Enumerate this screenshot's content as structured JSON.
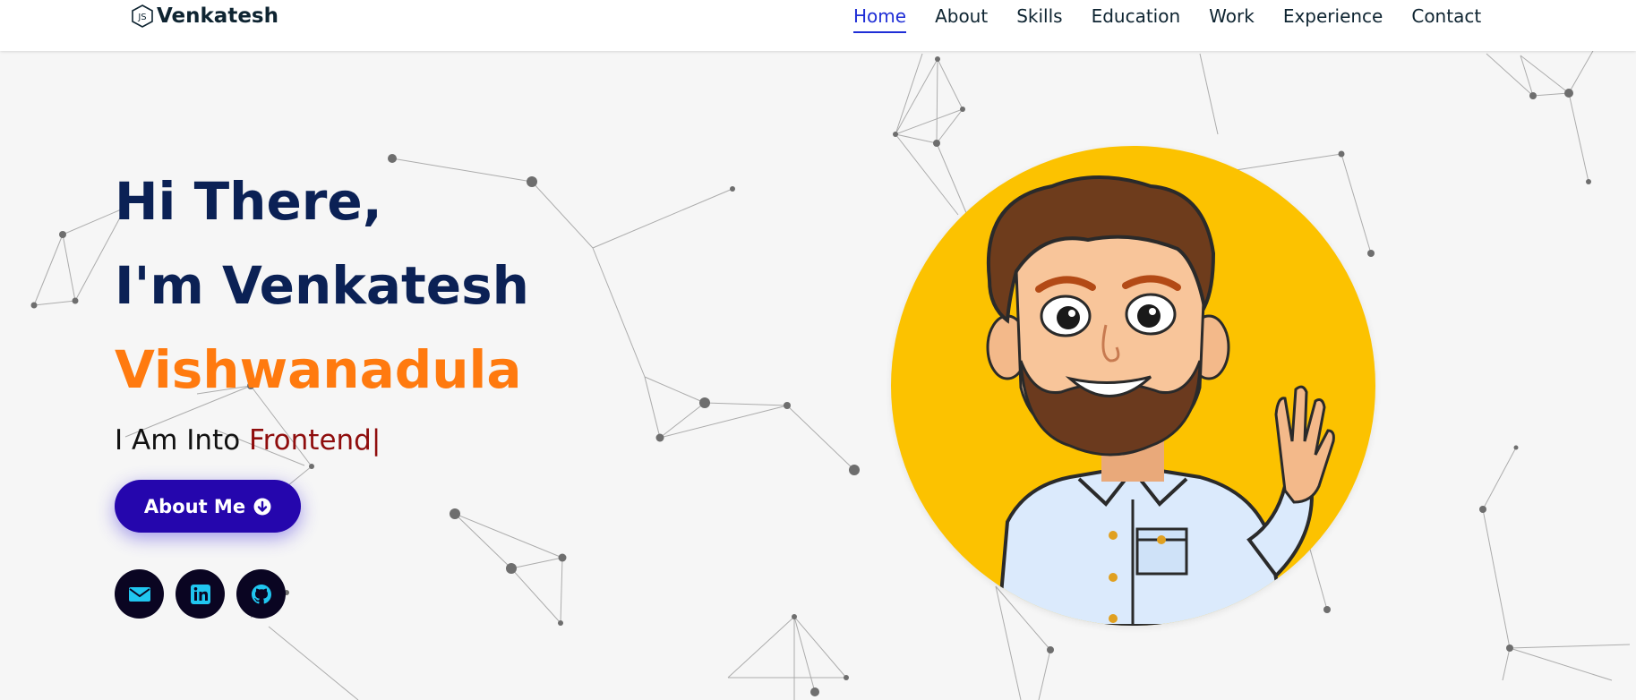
{
  "nav": {
    "brand": "Venkatesh",
    "links": [
      {
        "label": "Home",
        "active": true
      },
      {
        "label": "About",
        "active": false
      },
      {
        "label": "Skills",
        "active": false
      },
      {
        "label": "Education",
        "active": false
      },
      {
        "label": "Work",
        "active": false
      },
      {
        "label": "Experience",
        "active": false
      },
      {
        "label": "Contact",
        "active": false
      }
    ]
  },
  "hero": {
    "line1": "Hi There,",
    "line2": "I'm Venkatesh",
    "name": "Vishwanadula",
    "typing_prefix": "I Am Into",
    "typing_role": "Frontend",
    "typing_cursor": "|",
    "button_label": "About Me",
    "button_icon": "arrow-down-circle-icon"
  },
  "socials": [
    {
      "icon": "envelope-icon"
    },
    {
      "icon": "linkedin-icon"
    },
    {
      "icon": "github-icon"
    }
  ],
  "avatar": {
    "icon": "waving-man-avatar"
  },
  "colors": {
    "accent": "#1f2ed6",
    "heading": "#0b2155",
    "name": "#ff7a0f",
    "role": "#8f0d0d",
    "button": "#2506ad",
    "social_bg": "#0a0522",
    "social_icon": "#20c6f0",
    "avatar_bg": "#fcc200"
  }
}
